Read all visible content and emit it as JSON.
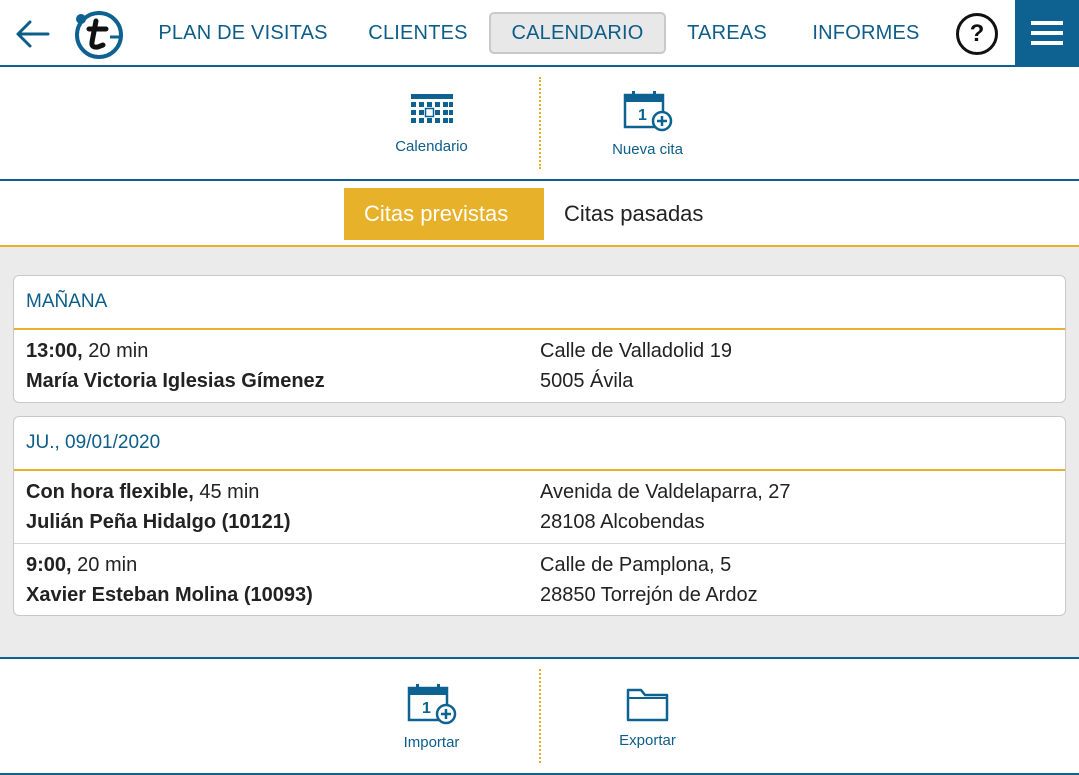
{
  "nav": {
    "items": [
      {
        "label": "PLAN DE VISITAS"
      },
      {
        "label": "CLIENTES"
      },
      {
        "label": "CALENDARIO"
      },
      {
        "label": "TAREAS"
      },
      {
        "label": "INFORMES"
      }
    ],
    "active": "CALENDARIO",
    "help_label": "?",
    "accent": "#0d6291"
  },
  "toolbar_top": {
    "calendar_label": "Calendario",
    "new_label": "Nueva cita"
  },
  "tabs": {
    "upcoming": "Citas previstas",
    "past": "Citas pasadas",
    "active_color": "#e8b12a"
  },
  "groups": [
    {
      "heading": "MAÑANA",
      "appointments": [
        {
          "time": "13:00,",
          "duration": "20 min",
          "client": "María Victoria Iglesias Gímenez",
          "street": "Calle de Valladolid 19",
          "city": "5005 Ávila"
        }
      ]
    },
    {
      "heading": "JU., 09/01/2020",
      "appointments": [
        {
          "time": "Con hora flexible,",
          "duration": "45 min",
          "client": "Julián Peña Hidalgo (10121)",
          "street": "Avenida de Valdelaparra, 27",
          "city": "28108 Alcobendas"
        },
        {
          "time": "9:00,",
          "duration": "20 min",
          "client": "Xavier Esteban Molina (10093)",
          "street": "Calle de Pamplona, 5",
          "city": "28850 Torrejón de Ardoz"
        }
      ]
    }
  ],
  "toolbar_bottom": {
    "import_label": "Importar",
    "export_label": "Exportar"
  }
}
